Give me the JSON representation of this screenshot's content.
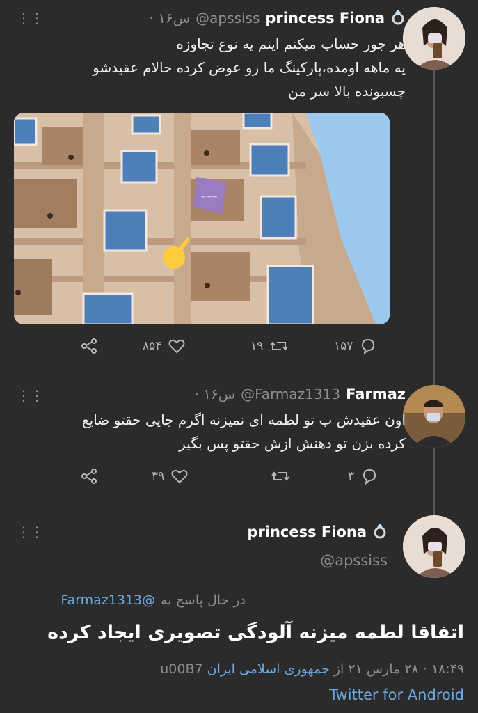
{
  "tweet1": {
    "name": "princess Fiona",
    "handle": "@apssiss",
    "time": "· ۱۶س",
    "text_line1": "هر جور حساب میکنم اینم یه نوع تجاوزه",
    "text_line2": "یه ماهه اومده،پارکینگ ما رو عوض کرده حالام عقیدشو",
    "text_line3": "چسبونده بالا سر من",
    "replies": "۱۵۷",
    "retweets": "۱۹",
    "likes": "۸۵۴"
  },
  "tweet2": {
    "name": "Farmaz",
    "handle": "@Farmaz1313",
    "time": "· ۱۶س",
    "text_line1": "اون عقیدش ب تو لطمه ای نمیزنه اگرم جایی حقتو ضایع",
    "text_line2": "کرده بزن تو دهنش ازش حقتو پس بگیر",
    "replies": "۳",
    "likes": "۳۹"
  },
  "main": {
    "name": "princess Fiona",
    "handle": "@apssiss",
    "replying_prefix": "در حال پاسخ به",
    "replying_to": "@Farmaz1313",
    "text": "اتفاقا لطمه میزنه آلودگی تصویری ایجاد کرده",
    "meta_prefix": "u00B7",
    "location": "جمهوری اسلامی ایران",
    "meta_date": "۱۸:۴۹ · ۲۸ مارس ۲۱ از",
    "source": "Twitter for Android"
  },
  "icons": {
    "ring": "ring-emoji",
    "pointing_hand": "pointing-hand-emoji",
    "reply": "reply-icon",
    "retweet": "retweet-icon",
    "like": "heart-icon",
    "share": "share-icon",
    "more": "more-dots-icon"
  },
  "colors": {
    "background": "#2b2b2b",
    "text": "#ffffff",
    "muted": "#8e8e8e",
    "link": "#6ba9e0",
    "thread_line": "#5a5a5a"
  }
}
